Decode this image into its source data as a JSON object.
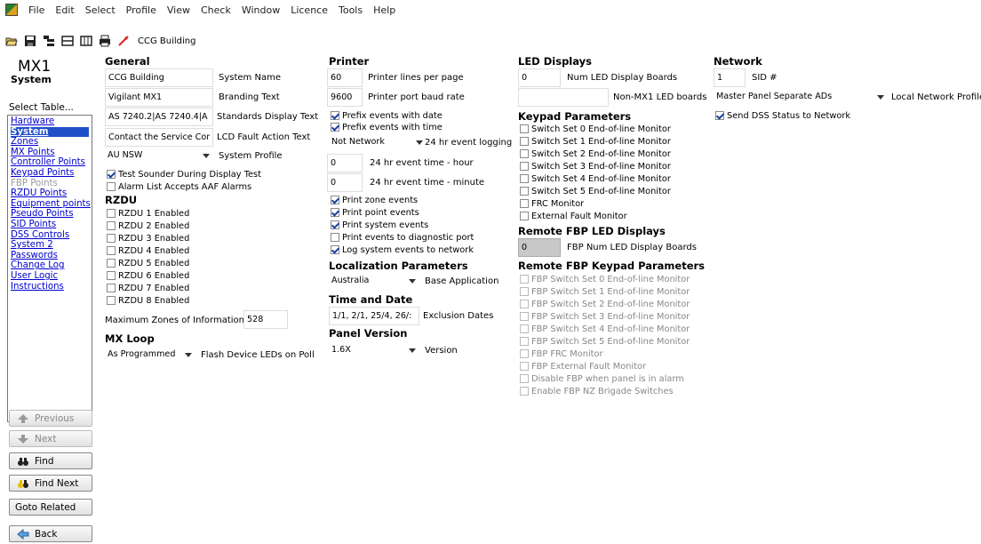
{
  "menu": [
    "File",
    "Edit",
    "Select",
    "Profile",
    "View",
    "Check",
    "Window",
    "Licence",
    "Tools",
    "Help"
  ],
  "toolbar": {
    "title": "CCG Building",
    "icons": [
      "open-folder-icon",
      "save-icon",
      "tree-icon",
      "list-icon",
      "table-icon",
      "print-icon",
      "edit-arrow-icon"
    ]
  },
  "left": {
    "title": "MX1",
    "subtitle": "System",
    "select_label": "Select Table...",
    "tables": [
      "Hardware",
      "System",
      "Zones",
      "MX Points",
      "Controller Points",
      "Keypad Points",
      "FBP Points",
      "RZDU Points",
      "Equipment points",
      "Pseudo Points",
      "SID Points",
      "DSS Controls",
      "System 2",
      "Passwords",
      "Change Log",
      "User Logic",
      "Instructions"
    ],
    "buttons": {
      "previous": "Previous",
      "next": "Next",
      "find": "Find",
      "find_next": "Find Next",
      "goto": "Goto Related",
      "back": "Back"
    }
  },
  "general": {
    "title": "General",
    "fields": [
      {
        "value": "CCG Building",
        "label": "System Name"
      },
      {
        "value": "Vigilant MX1",
        "label": "Branding Text"
      },
      {
        "value": "AS 7240.2|AS 7240.4|A",
        "label": "Standards Display Text"
      },
      {
        "value": "Contact the Service Cor",
        "label": "LCD Fault Action Text"
      }
    ],
    "profile": {
      "value": "AU NSW",
      "label": "System Profile"
    },
    "checks": [
      {
        "label": "Test Sounder During Display Test",
        "checked": true
      },
      {
        "label": "Alarm List Accepts AAF Alarms",
        "checked": false
      }
    ]
  },
  "rzdu": {
    "title": "RZDU",
    "items": [
      "RZDU 1 Enabled",
      "RZDU 2 Enabled",
      "RZDU 3 Enabled",
      "RZDU 4 Enabled",
      "RZDU 5 Enabled",
      "RZDU 6 Enabled",
      "RZDU 7 Enabled",
      "RZDU 8 Enabled"
    ],
    "max_label": "Maximum Zones of Information",
    "max_value": "528"
  },
  "mxloop": {
    "title": "MX Loop",
    "value": "As Programmed",
    "label": "Flash Device LEDs on Poll"
  },
  "printer": {
    "title": "Printer",
    "lines": {
      "value": "60",
      "label": "Printer lines per page"
    },
    "baud": {
      "value": "9600",
      "label": "Printer port baud rate"
    },
    "checks1": [
      {
        "label": "Prefix events with date",
        "checked": true
      },
      {
        "label": "Prefix events with time",
        "checked": true
      }
    ],
    "logging": {
      "value": "Not Network",
      "label": "24 hr event logging"
    },
    "hour": {
      "value": "0",
      "label": "24 hr event time - hour"
    },
    "minute": {
      "value": "0",
      "label": "24 hr event time - minute"
    },
    "checks2": [
      {
        "label": "Print zone events",
        "checked": true
      },
      {
        "label": "Print point events",
        "checked": true
      },
      {
        "label": "Print system events",
        "checked": true
      },
      {
        "label": "Print events to diagnostic port",
        "checked": false
      },
      {
        "label": "Log system events to network",
        "checked": true
      }
    ]
  },
  "localization": {
    "title": "Localization Parameters",
    "value": "Australia",
    "label": "Base Application"
  },
  "timedate": {
    "title": "Time and Date",
    "value": "1/1, 2/1, 25/4, 26/:",
    "label": "Exclusion Dates"
  },
  "version": {
    "title": "Panel Version",
    "value": "1.6X",
    "label": "Version"
  },
  "led": {
    "title": "LED Displays",
    "num": {
      "value": "0",
      "label": "Num LED Display Boards"
    },
    "nonmx": {
      "value": "",
      "label": "Non-MX1 LED boards"
    }
  },
  "keypad": {
    "title": "Keypad Parameters",
    "items": [
      "Switch Set 0 End-of-line Monitor",
      "Switch Set 1 End-of-line Monitor",
      "Switch Set 2 End-of-line Monitor",
      "Switch Set 3 End-of-line Monitor",
      "Switch Set 4 End-of-line Monitor",
      "Switch Set 5 End-of-line Monitor",
      "FRC Monitor",
      "External Fault Monitor"
    ]
  },
  "fbpled": {
    "title": "Remote FBP LED Displays",
    "value": "0",
    "label": "FBP Num LED Display Boards"
  },
  "fbpkeypad": {
    "title": "Remote FBP Keypad Parameters",
    "items": [
      "FBP Switch Set 0 End-of-line Monitor",
      "FBP Switch Set 1 End-of-line Monitor",
      "FBP Switch Set 2 End-of-line Monitor",
      "FBP Switch Set 3 End-of-line Monitor",
      "FBP Switch Set 4 End-of-line Monitor",
      "FBP Switch Set 5 End-of-line Monitor",
      "FBP FRC Monitor",
      "FBP External Fault Monitor",
      "Disable FBP when panel is in alarm",
      "Enable FBP NZ Brigade Switches"
    ]
  },
  "network": {
    "title": "Network",
    "sid": {
      "value": "1",
      "label": "SID #"
    },
    "profile": {
      "value": "Master Panel Separate ADs",
      "label": "Local Network Profile"
    },
    "check": {
      "label": "Send DSS Status to Network",
      "checked": true
    }
  }
}
